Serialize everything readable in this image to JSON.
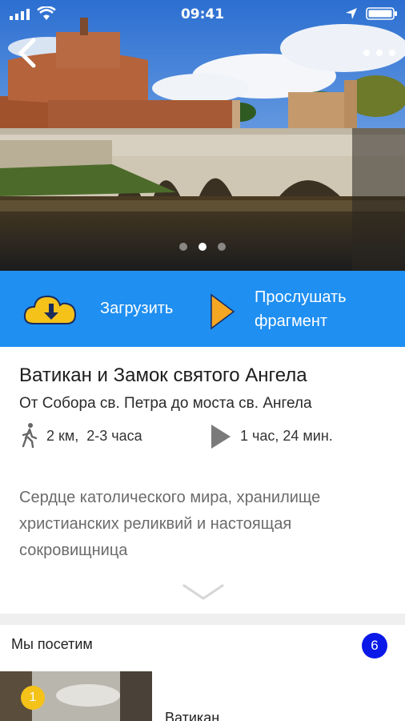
{
  "status_bar": {
    "time": "09:41"
  },
  "hero": {
    "slide_count": 3,
    "active_slide_index": 1
  },
  "actions": {
    "download_label": "Загрузить",
    "listen_label_line1": "Прослушать",
    "listen_label_line2": "фрагмент",
    "download_icon_color": "#f5c21a",
    "play_icon_color": "#f5a623"
  },
  "tour": {
    "title": "Ватикан и Замок святого Ангела",
    "subtitle": "От Собора св. Петра до моста св. Ангела",
    "distance": "2 км,",
    "walk_time": "2-3 часа",
    "audio_duration": "1 час, 24 мин.",
    "description": "Сердце католического мира, хранилище христианских реликвий и настоящая сокровищница"
  },
  "visit": {
    "title": "Мы посетим",
    "count": "6",
    "places": [
      {
        "number": "1",
        "name": "Ватикан"
      }
    ]
  },
  "colors": {
    "action_bar": "#1f8ff1",
    "count_badge": "#0a18e8",
    "place_badge": "#f5c21a"
  },
  "icons": {
    "back": "chevron-left-icon",
    "more": "more-dots-icon",
    "download": "cloud-download-icon",
    "play": "play-triangle-icon",
    "walk": "walking-person-icon",
    "expand": "chevron-down-icon"
  }
}
